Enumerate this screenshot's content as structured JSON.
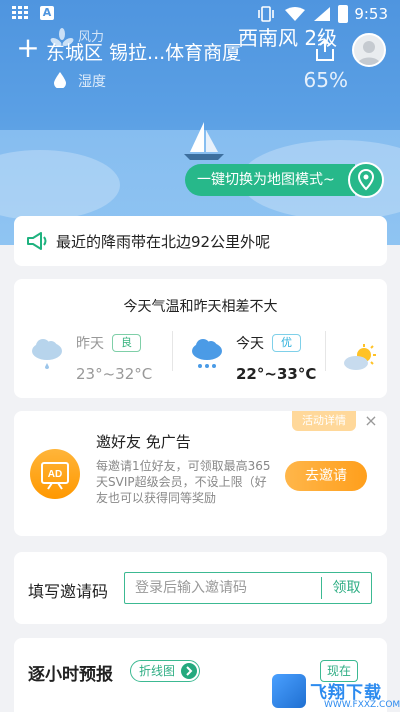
{
  "status_bar": {
    "time": "9:53",
    "app_icon_letter": "A"
  },
  "header": {
    "location": "东城区 锡拉...体育商厦",
    "wind_label": "风力",
    "wind_value": "西南风 2级",
    "humidity_label": "湿度",
    "humidity_value": "65%",
    "add_icon": "plus-icon",
    "share_icon": "share-icon"
  },
  "map_switch": {
    "label": "一键切换为地图模式~"
  },
  "rain_notice": {
    "text": "最近的降雨带在北边92公里外呢"
  },
  "comparison": {
    "title": "今天气温和昨天相差不大",
    "days": [
      {
        "name": "昨天",
        "aqi": "良",
        "temp": "23°~32°C",
        "icon": "light-rain-icon"
      },
      {
        "name": "今天",
        "aqi": "优",
        "temp": "22°~33°C",
        "icon": "rain-icon"
      }
    ],
    "next_icon": "partly-sunny-icon"
  },
  "invite": {
    "tag": "活动详情",
    "title": "邀好友 免广告",
    "desc": "每邀请1位好友，可领取最高365天SVIP超级会员，不设上限（好友也可以获得同等奖励",
    "button": "去邀请",
    "badge_text": "AD"
  },
  "code": {
    "label": "填写邀请码",
    "placeholder": "登录后输入邀请码",
    "button": "领取"
  },
  "hourly": {
    "title": "逐小时预报",
    "toggle": "折线图",
    "now": "现在"
  },
  "watermark": {
    "text": "飞翔下载",
    "sub": "WWW.FXXZ.COM"
  },
  "colors": {
    "accent_green": "#27b88a",
    "orange": "#ff9f1c",
    "sky_blue": "#4f95df"
  }
}
